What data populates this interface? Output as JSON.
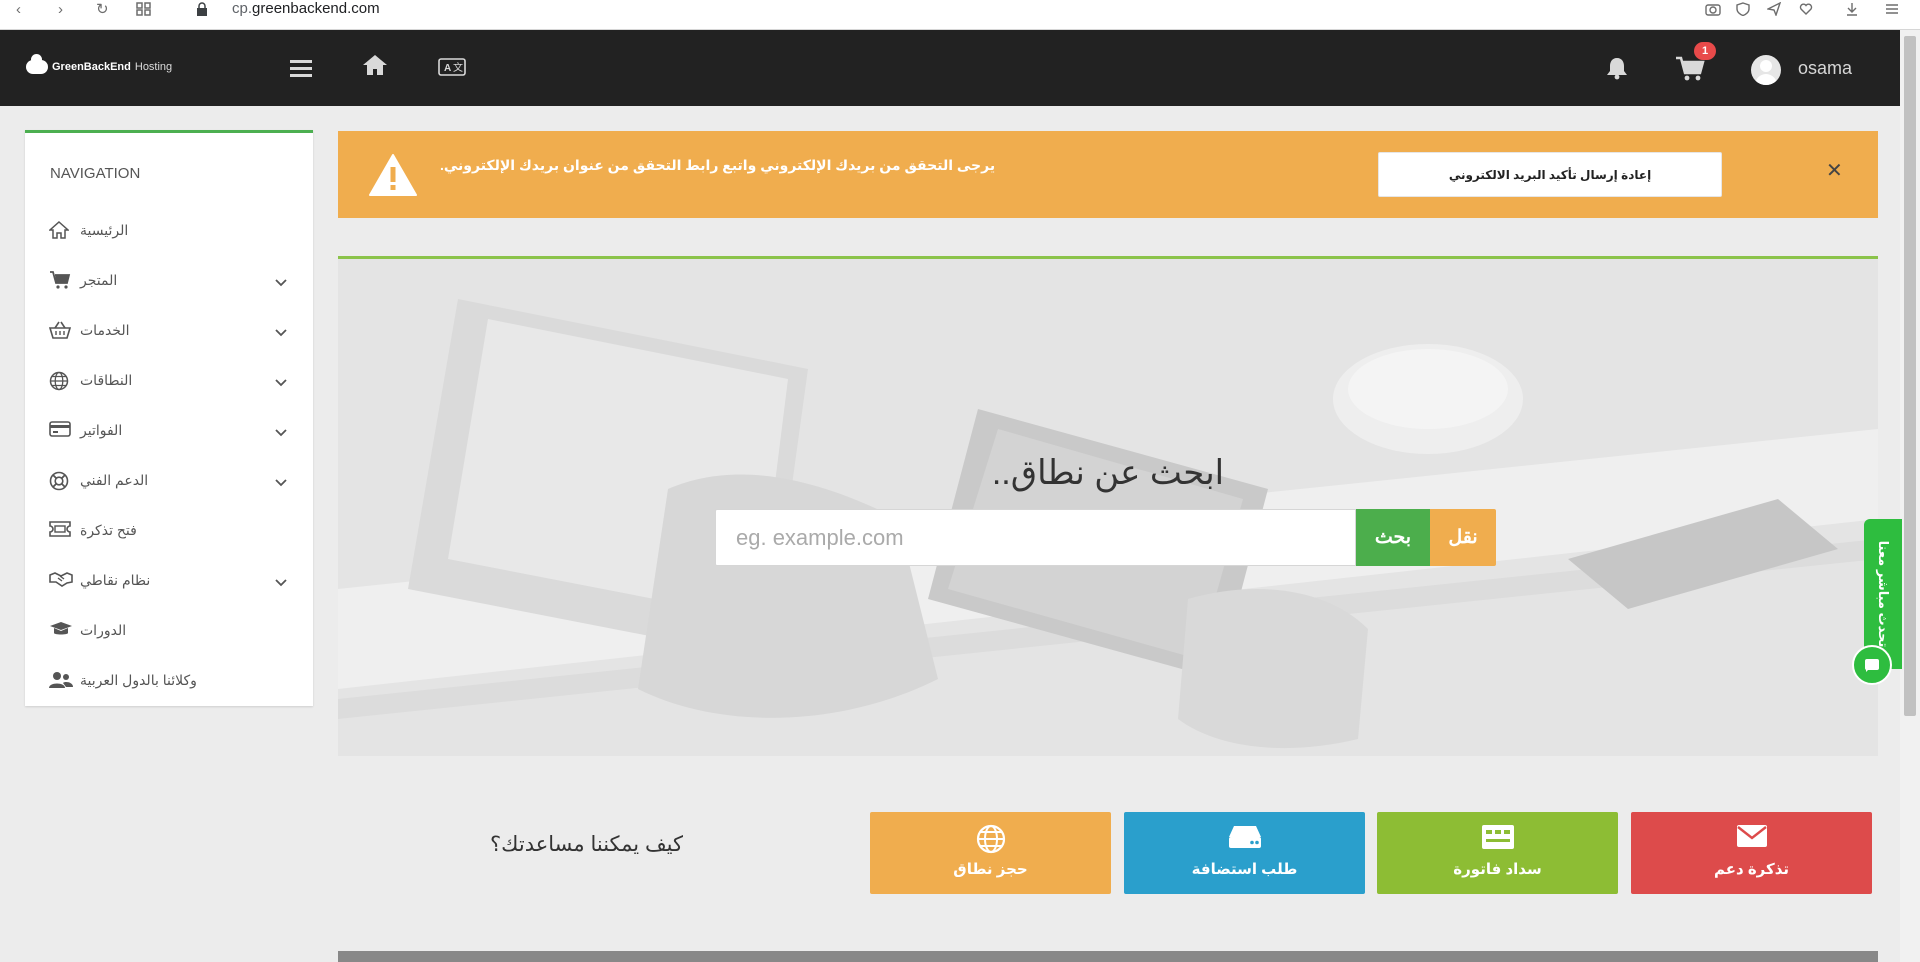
{
  "browser": {
    "url_domain": "cp.",
    "url_main": "greenbackend.com"
  },
  "topnav": {
    "logo_bold": "GreenBackEnd",
    "logo_light": "Hosting",
    "cart_count": "1",
    "username": "osama"
  },
  "sidebar": {
    "title": "NAVIGATION",
    "items": [
      {
        "label": "الرئيسية",
        "icon": "home-icon",
        "has_children": false
      },
      {
        "label": "المتجر",
        "icon": "cart-icon",
        "has_children": true
      },
      {
        "label": "الخدمات",
        "icon": "basket-icon",
        "has_children": true
      },
      {
        "label": "النطاقات",
        "icon": "globe-icon",
        "has_children": true
      },
      {
        "label": "الفواتير",
        "icon": "credit-card-icon",
        "has_children": true
      },
      {
        "label": "الدعم الفني",
        "icon": "lifebuoy-icon",
        "has_children": true
      },
      {
        "label": "فتح تذكرة",
        "icon": "ticket-icon",
        "has_children": false
      },
      {
        "label": "نظام نقاطي",
        "icon": "handshake-icon",
        "has_children": true
      },
      {
        "label": "الدورات",
        "icon": "graduation-cap-icon",
        "has_children": false
      },
      {
        "label": "وكلائنا بالدول العربية",
        "icon": "users-icon",
        "has_children": false
      }
    ]
  },
  "alert": {
    "message": "يرجى التحقق من بريدك الإلكتروني واتبع رابط التحقق من عنوان بريدك الإلكتروني.",
    "resend_label": "إعادة إرسال تأكيد البريد الالكتروني"
  },
  "hero": {
    "title": "ابحث عن نطاق..",
    "search_placeholder": "eg. example.com",
    "search_label": "بحث",
    "transfer_label": "نقل"
  },
  "chat": {
    "tab_label": "تحدث مباشر معنا"
  },
  "help": {
    "question": "كيف يمكننا مساعدتك؟",
    "tiles": [
      {
        "label": "حجز نطاق",
        "icon": "globe-icon",
        "color": "#f0ad4e"
      },
      {
        "label": "طلب استضافة",
        "icon": "server-icon",
        "color": "#2a9fcc"
      },
      {
        "label": "سداد فاتورة",
        "icon": "invoice-icon",
        "color": "#8dbd34"
      },
      {
        "label": "تذكرة دعم",
        "icon": "envelope-icon",
        "color": "#dd4b4b"
      }
    ]
  },
  "colors": {
    "topnav_bg": "#222222",
    "alert_bg": "#f0ad4e",
    "accent_green": "#4caf50",
    "search_button": "#4cae4c"
  }
}
